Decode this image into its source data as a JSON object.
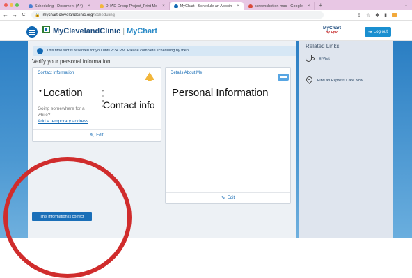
{
  "browser": {
    "tabs": [
      {
        "label": "Scheduling - Document (A4)",
        "color": "#4a7fd1"
      },
      {
        "label": "DHAD Group Project_Print Mo",
        "color": "#f2b63a"
      },
      {
        "label": "MyChart - Schedule an Appoin",
        "color": "#1168b3"
      },
      {
        "label": "screenshot on mac - Google",
        "color": "#d84a3a"
      }
    ],
    "new_tab": "+",
    "back": "←",
    "forward": "→",
    "reload": "C",
    "lock": "🔒",
    "url_domain": "mychart.clevelandclinic.org",
    "url_path": "/Scheduling"
  },
  "header": {
    "brand": "MyClevelandClinic",
    "brand_sep": "|",
    "brand_app": "MyChart",
    "epic_top": "MyChart",
    "epic_bottom": "by Epic",
    "logout": "Log out"
  },
  "notice": {
    "text": "This time slot is reserved for you until 2:34 PM. Please complete scheduling by then.",
    "icon": "i"
  },
  "main": {
    "title": "Verify your personal information",
    "contact_card": {
      "header": "Contact Information",
      "location_heading": "Location",
      "location_bullet": "•",
      "location_question": "Going somewhere for a while?",
      "location_link": "Add a temporary address",
      "contact_info": "Contact info",
      "glyphs": [
        "ס",
        "0",
        "ם",
        "ⅹ"
      ],
      "edit": "Edit"
    },
    "details_card": {
      "header": "Details About Me",
      "personal_heading": "Personal Information",
      "edit": "Edit"
    },
    "confirm_button": "This information is correct"
  },
  "sidebar": {
    "title": "Related Links",
    "links": [
      {
        "label": "E-Visit",
        "icon": "stethoscope-icon"
      },
      {
        "label": "Find an Express Care Now",
        "icon": "location-pin-icon"
      }
    ]
  },
  "colors": {
    "accent": "#1168b3",
    "annotation": "#d02c2c",
    "background_blue": "#2c7fc4"
  }
}
